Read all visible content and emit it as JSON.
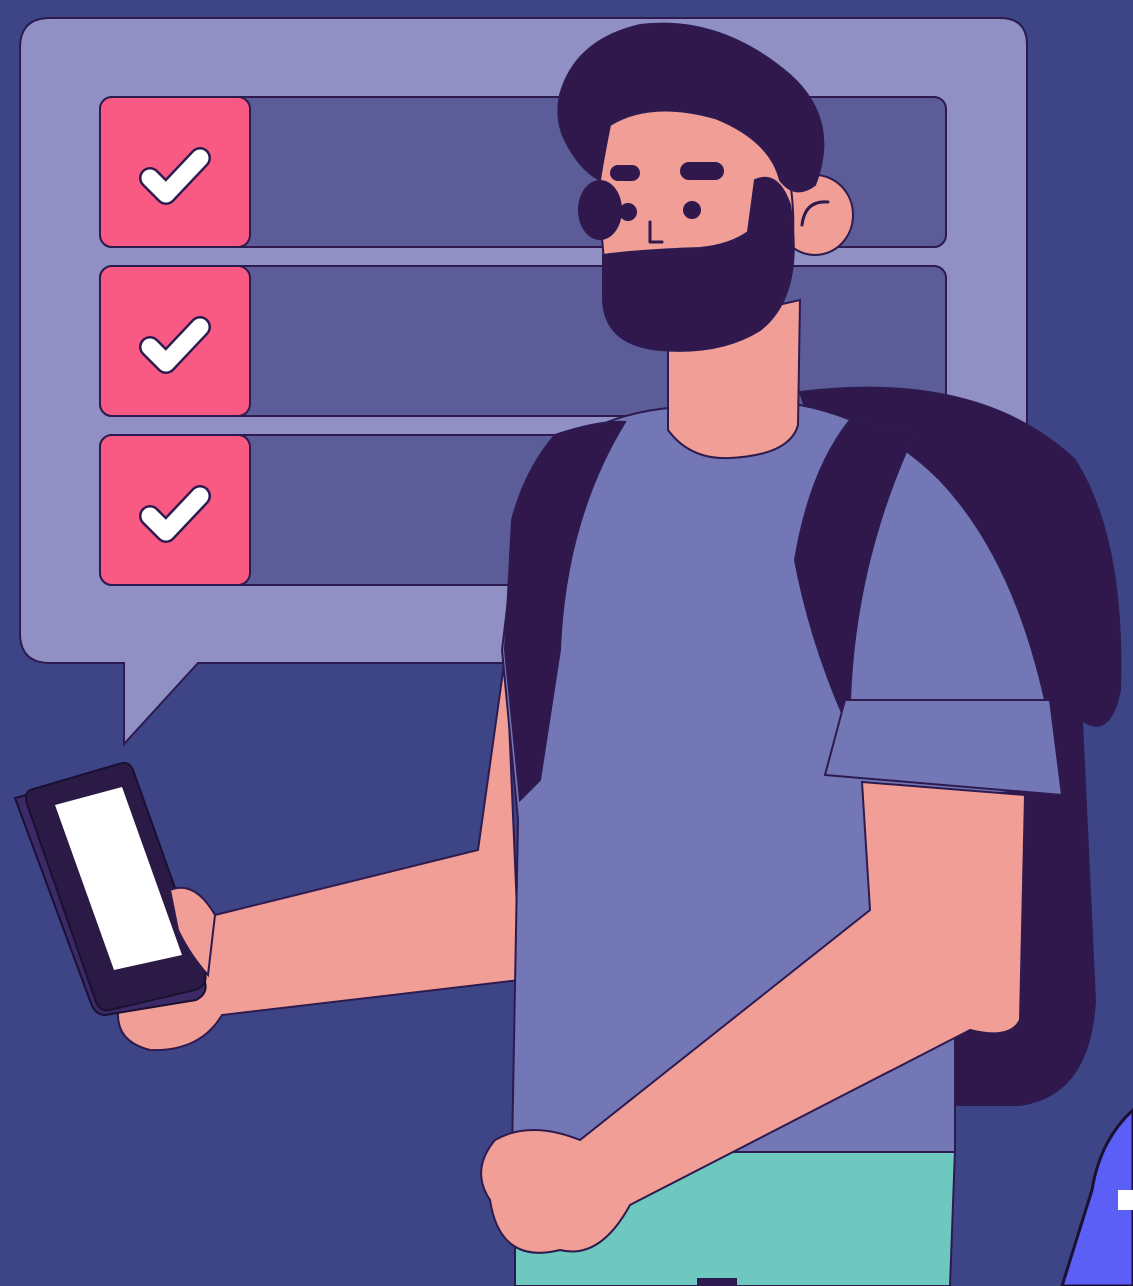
{
  "scene": {
    "checklist": {
      "items": [
        {
          "checked": true
        },
        {
          "checked": true
        },
        {
          "checked": true
        }
      ]
    },
    "icons": {
      "checkbox": "check-icon",
      "device": "smartphone-icon"
    },
    "colors": {
      "background": "#3e4587",
      "bubble": "#9090c5",
      "bar": "#5c5d98",
      "checkbox": "#f95a84",
      "outline": "#2d1a4f",
      "skin": "#f09e96",
      "shirt": "#7477b5",
      "hair": "#30184d",
      "pants": "#6ec8bf",
      "accent_corner": "#5b5ff5"
    }
  }
}
